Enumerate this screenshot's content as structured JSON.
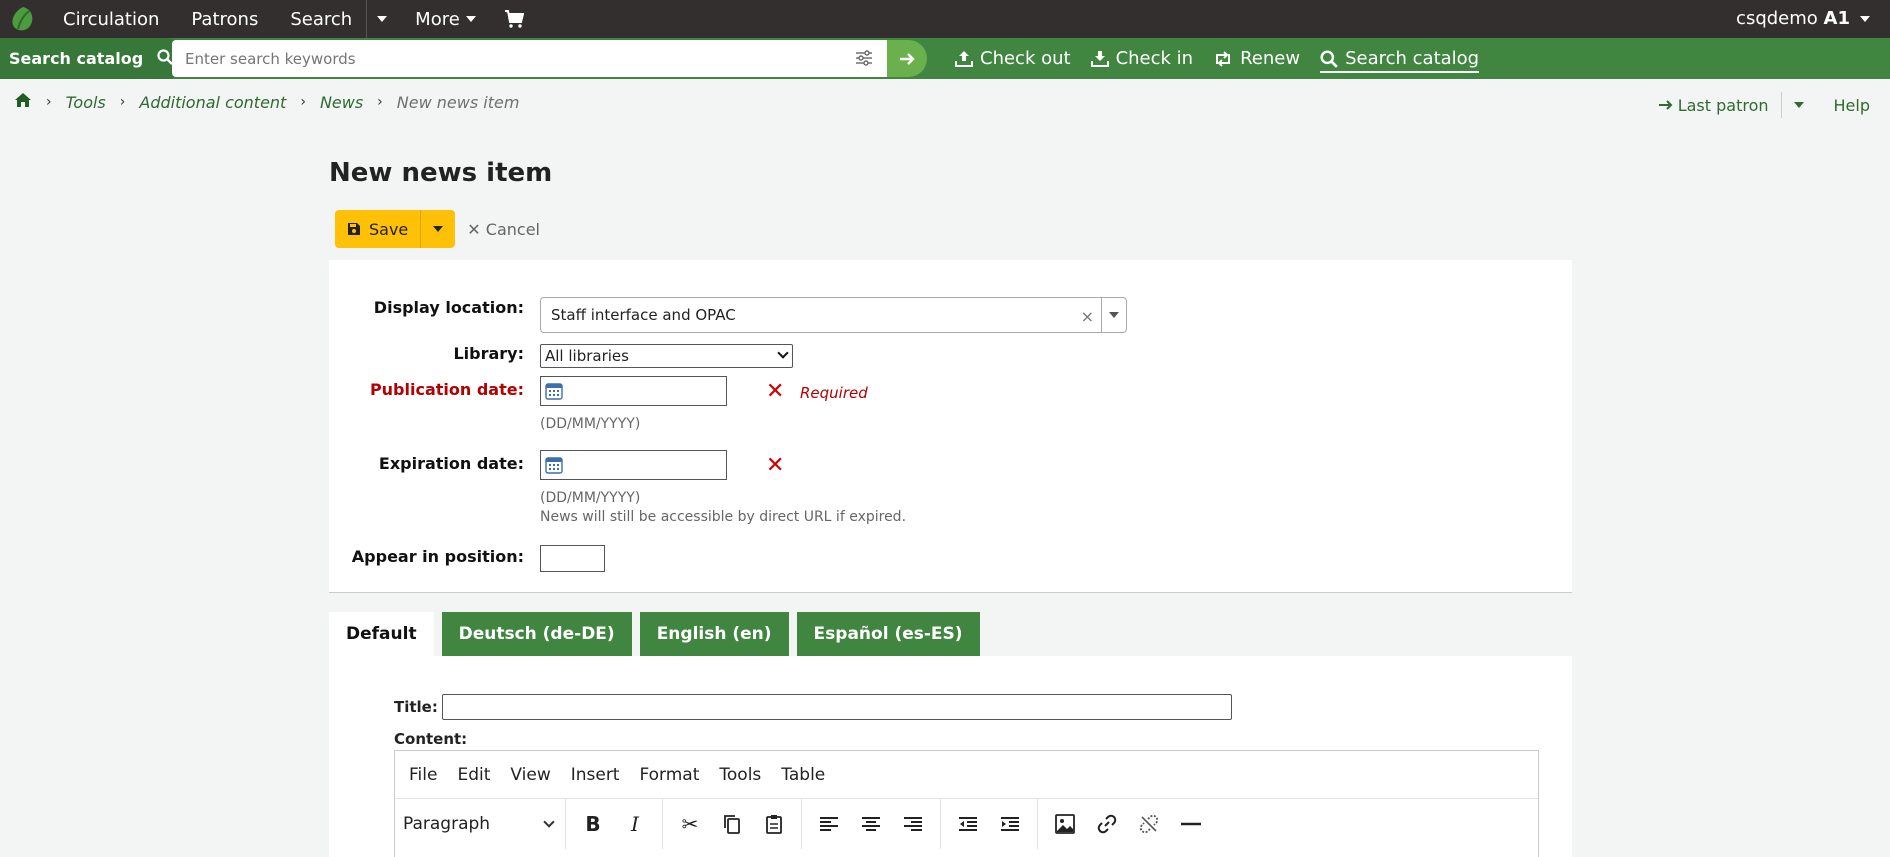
{
  "topnav": {
    "items": [
      "Circulation",
      "Patrons",
      "Search",
      "More"
    ],
    "user_name": "csqdemo",
    "user_branch": "A1"
  },
  "searchbar": {
    "label": "Search catalog",
    "placeholder": "Enter search keywords",
    "actions": [
      "Check out",
      "Check in",
      "Renew",
      "Search catalog"
    ]
  },
  "breadcrumb": {
    "items": [
      "Tools",
      "Additional content",
      "News"
    ],
    "current": "New news item"
  },
  "right_links": {
    "last_patron": "Last patron",
    "help": "Help"
  },
  "page": {
    "title": "New news item",
    "save_label": "Save",
    "cancel_label": "Cancel"
  },
  "form": {
    "display_location_label": "Display location:",
    "display_location_value": "Staff interface and OPAC",
    "library_label": "Library:",
    "library_value": "All libraries",
    "publication_label": "Publication date:",
    "required_text": "Required",
    "date_format": "(DD/MM/YYYY)",
    "expiration_label": "Expiration date:",
    "expiration_note": "News will still be accessible by direct URL if expired.",
    "position_label": "Appear in position:"
  },
  "tabs": [
    "Default",
    "Deutsch (de-DE)",
    "English (en)",
    "Español (es-ES)"
  ],
  "editor": {
    "title_label": "Title:",
    "content_label": "Content:",
    "menu": [
      "File",
      "Edit",
      "View",
      "Insert",
      "Format",
      "Tools",
      "Table"
    ],
    "block_format": "Paragraph"
  },
  "colors": {
    "topbar": "#332f2f",
    "searchbar": "#408540",
    "link": "#2e6b30",
    "save_button": "#ffc107",
    "required": "#b30000"
  }
}
